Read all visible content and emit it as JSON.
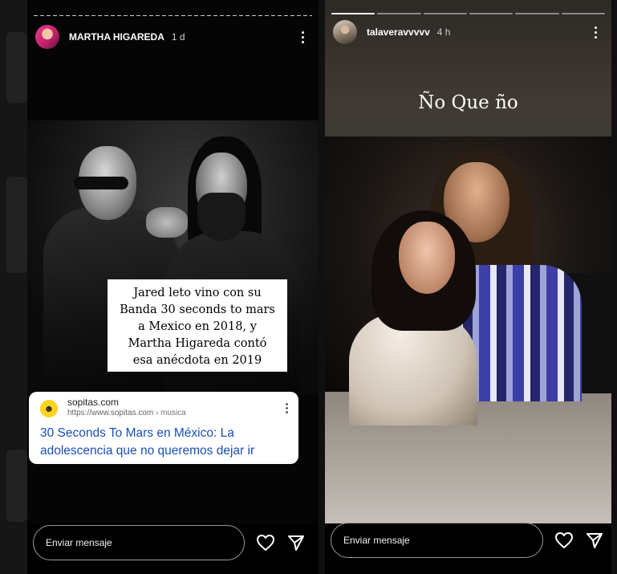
{
  "left_story": {
    "username": "MARTHA HIGAREDA",
    "time": "1 d",
    "caption_lines": [
      "Jared leto vino con su",
      "Banda 30 seconds to mars",
      "a Mexico en 2018, y",
      "Martha Higareda contó",
      "esa anécdota en 2019"
    ],
    "link_card": {
      "site": "sopitas.com",
      "url": "https://www.sopitas.com",
      "url_path": " › musica",
      "title": "30 Seconds To Mars en México: La adolescencia que no queremos dejar ir"
    },
    "message_placeholder": "Enviar mensaje"
  },
  "right_story": {
    "username": "talaveravvvvv",
    "time": "4 h",
    "overlay_text": "Ño Que ño",
    "message_placeholder": "Enviar mensaje",
    "progress_segments": 6
  },
  "icons": {
    "like": "heart-icon",
    "share": "send-icon",
    "options": "more-vertical-icon"
  },
  "colors": {
    "link": "#1a4fb8",
    "card_bg": "#ffffff",
    "page_bg": "#000000"
  }
}
